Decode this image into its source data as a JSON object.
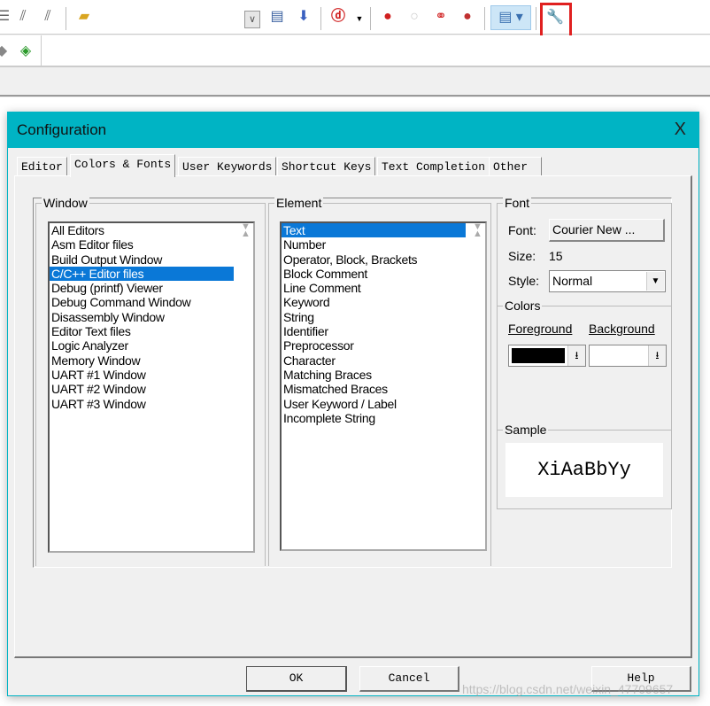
{
  "toolbar": {
    "highlight_color": "#e02020",
    "icons": [
      "indent-icon",
      "unindent-icon",
      "comment-icon",
      "open-folder-icon",
      "dropdown-icon",
      "find-in-files-icon",
      "find-icon",
      "debug-icon",
      "breakpoint-icon",
      "disable-breakpoint-icon",
      "enable-breakpoints-icon",
      "kill-breakpoints-icon",
      "window-layout-icon",
      "configuration-wrench-icon",
      "manage-components-icon",
      "pack-installer-icon"
    ]
  },
  "dialog": {
    "title": "Configuration",
    "close": "X",
    "title_color": "#00b4c4",
    "tabs": [
      "Editor",
      "Colors & Fonts",
      "User Keywords",
      "Shortcut Keys",
      "Text Completion",
      "Other"
    ],
    "window_group": {
      "label": "Window",
      "items": [
        "All Editors",
        "Asm Editor files",
        "Build Output Window",
        "C/C++ Editor files",
        "Debug (printf) Viewer",
        "Debug Command Window",
        "Disassembly Window",
        "Editor Text files",
        "Logic Analyzer",
        "Memory Window",
        "UART #1 Window",
        "UART #2 Window",
        "UART #3 Window"
      ],
      "selected": "C/C++ Editor files"
    },
    "element_group": {
      "label": "Element",
      "items": [
        "Text",
        "Number",
        "Operator, Block, Brackets",
        "Block Comment",
        "Line Comment",
        "Keyword",
        "String",
        "Identifier",
        "Preprocessor",
        "Character",
        "Matching Braces",
        "Mismatched Braces",
        "User Keyword / Label",
        "Incomplete String"
      ],
      "selected": "Text"
    },
    "font_group": {
      "label": "Font",
      "font_label": "Font:",
      "font_value": "Courier New ...",
      "size_label": "Size:",
      "size_value": "15",
      "style_label": "Style:",
      "style_value": "Normal"
    },
    "colors_group": {
      "label": "Colors",
      "foreground_label": "Foreground",
      "background_label": "Background",
      "foreground_color": "#000000",
      "background_color": "#ffffff"
    },
    "sample_group": {
      "label": "Sample",
      "text": "XiAaBbYy"
    },
    "buttons": {
      "ok": "OK",
      "cancel": "Cancel",
      "help": "Help"
    }
  },
  "watermark": "https://blog.csdn.net/weixin_47709657"
}
